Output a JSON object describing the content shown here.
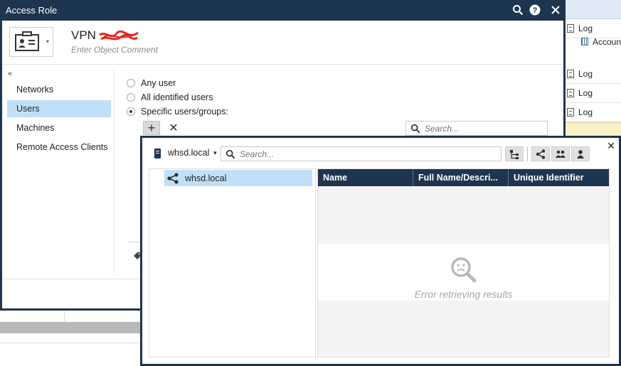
{
  "background": {
    "right_list": [
      {
        "label": "Log",
        "icon": "document-icon"
      },
      {
        "label": "Accoun",
        "icon": "calculator-icon"
      },
      {
        "label": "Log",
        "icon": "document-icon"
      },
      {
        "label": "Log",
        "icon": "document-icon"
      },
      {
        "label": "Log",
        "icon": "document-icon"
      }
    ]
  },
  "access_role": {
    "title": "Access Role",
    "object_name": "VPN",
    "object_comment": "Enter Object Comment",
    "nav": {
      "collapse_glyph": "«",
      "items": [
        {
          "label": "Networks"
        },
        {
          "label": "Users"
        },
        {
          "label": "Machines"
        },
        {
          "label": "Remote Access Clients"
        }
      ],
      "active_index": 1
    },
    "users": {
      "options": [
        "Any user",
        "All identified users",
        "Specific users/groups:"
      ],
      "selected_index": 2,
      "add_glyph": "+",
      "remove_glyph": "✕",
      "search_placeholder": "Search..."
    }
  },
  "picker": {
    "domain": "whsd.local",
    "search_placeholder": "Search...",
    "tree_node": "whsd.local",
    "columns": [
      "Name",
      "Full Name/Descri...",
      "Unique Identifier"
    ],
    "error_message": "Error retrieving results",
    "filter_buttons": [
      "tree-view-icon",
      "share-icon",
      "group-icon",
      "user-icon"
    ],
    "colors": {
      "header": "#1e3550",
      "selection": "#bfe0f8",
      "accent": "#1e3550"
    }
  }
}
